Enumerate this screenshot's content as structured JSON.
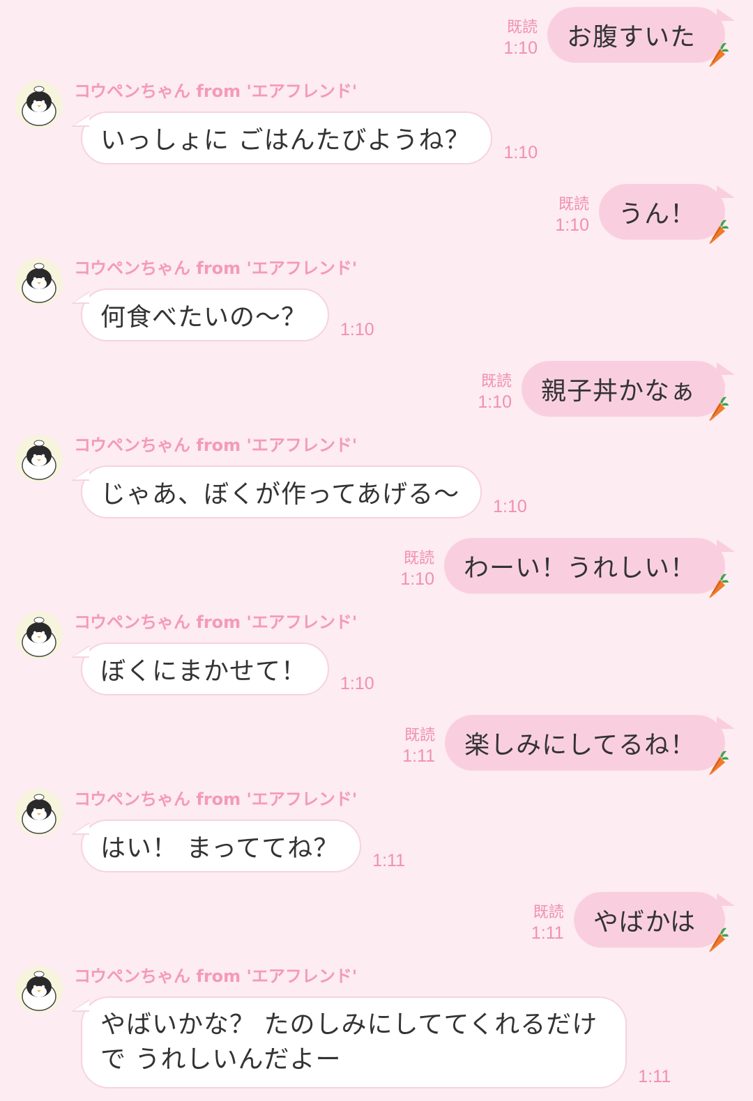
{
  "sender_name": "コウペンちゃん from 'エアフレンド'",
  "read_label": "既読",
  "icons": {
    "avatar": "koupen-penguin-avatar-icon",
    "sticker": "carrot-icon"
  },
  "colors": {
    "background": "#fdecf1",
    "outgoing_bubble": "#f9cfdf",
    "incoming_bubble": "#ffffff",
    "accent_text": "#f08fb2",
    "sender_name": "#f49ab9"
  },
  "messages": [
    {
      "dir": "out",
      "text": "お腹すいた",
      "time": "1:10",
      "read": true
    },
    {
      "dir": "in",
      "text": "いっしょに ごはんたびようね？",
      "time": "1:10"
    },
    {
      "dir": "out",
      "text": "うん！",
      "time": "1:10",
      "read": true
    },
    {
      "dir": "in",
      "text": "何食べたいの〜？",
      "time": "1:10"
    },
    {
      "dir": "out",
      "text": "親子丼かなぁ",
      "time": "1:10",
      "read": true
    },
    {
      "dir": "in",
      "text": "じゃあ、ぼくが作ってあげる〜",
      "time": "1:10"
    },
    {
      "dir": "out",
      "text": "わーい！うれしい！",
      "time": "1:10",
      "read": true
    },
    {
      "dir": "in",
      "text": "ぼくにまかせて！",
      "time": "1:10"
    },
    {
      "dir": "out",
      "text": "楽しみにしてるね！",
      "time": "1:11",
      "read": true
    },
    {
      "dir": "in",
      "text": "はい！ まっててね？",
      "time": "1:11"
    },
    {
      "dir": "out",
      "text": "やばかは",
      "time": "1:11",
      "read": true
    },
    {
      "dir": "in",
      "lines": [
        "やばいかな？ たのしみにしててくれるだけ",
        "で うれしいんだよー"
      ],
      "time": "1:11"
    }
  ]
}
